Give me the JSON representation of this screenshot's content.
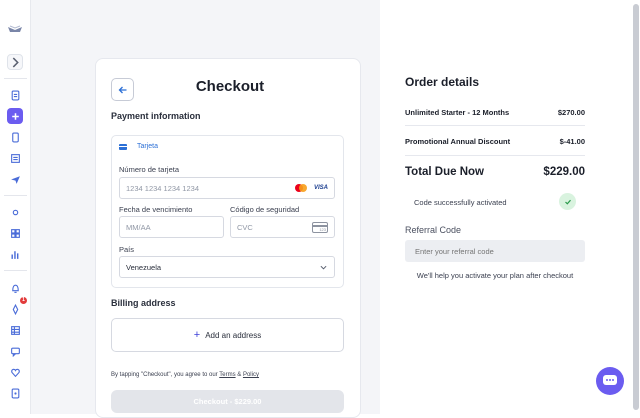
{
  "checkout": {
    "title": "Checkout",
    "payment_heading": "Payment information",
    "tab_label": "Tarjeta",
    "card_number_label": "Número de tarjeta",
    "card_number_placeholder": "1234 1234 1234 1234",
    "visa_text": "VISA",
    "expiry_label": "Fecha de vencimiento",
    "expiry_placeholder": "MM/AA",
    "cvc_label": "Código de seguridad",
    "cvc_placeholder": "CVC",
    "cvc_icon_text": "123",
    "country_label": "País",
    "country_value": "Venezuela",
    "billing_heading": "Billing address",
    "add_address_label": "Add an address",
    "agree_prefix": "By tapping \"Checkout\", you agree to our",
    "terms_label": "Terms",
    "and_text": "&",
    "policy_label": "Policy",
    "checkout_button": "Checkout - $229.00"
  },
  "order": {
    "title": "Order details",
    "items": [
      {
        "name": "Unlimited Starter - 12 Months",
        "price": "$270.00"
      },
      {
        "name": "Promotional Annual Discount",
        "price": "$-41.00"
      }
    ],
    "total_label": "Total Due Now",
    "total_value": "$229.00",
    "code_status": "Code successfully activated",
    "referral_label": "Referral Code",
    "referral_placeholder": "Enter your referral code",
    "help_text": "We'll help you activate your plan after checkout"
  },
  "sidebar": {
    "badge_count": "1",
    "accent_color": "#6b5cf0"
  }
}
